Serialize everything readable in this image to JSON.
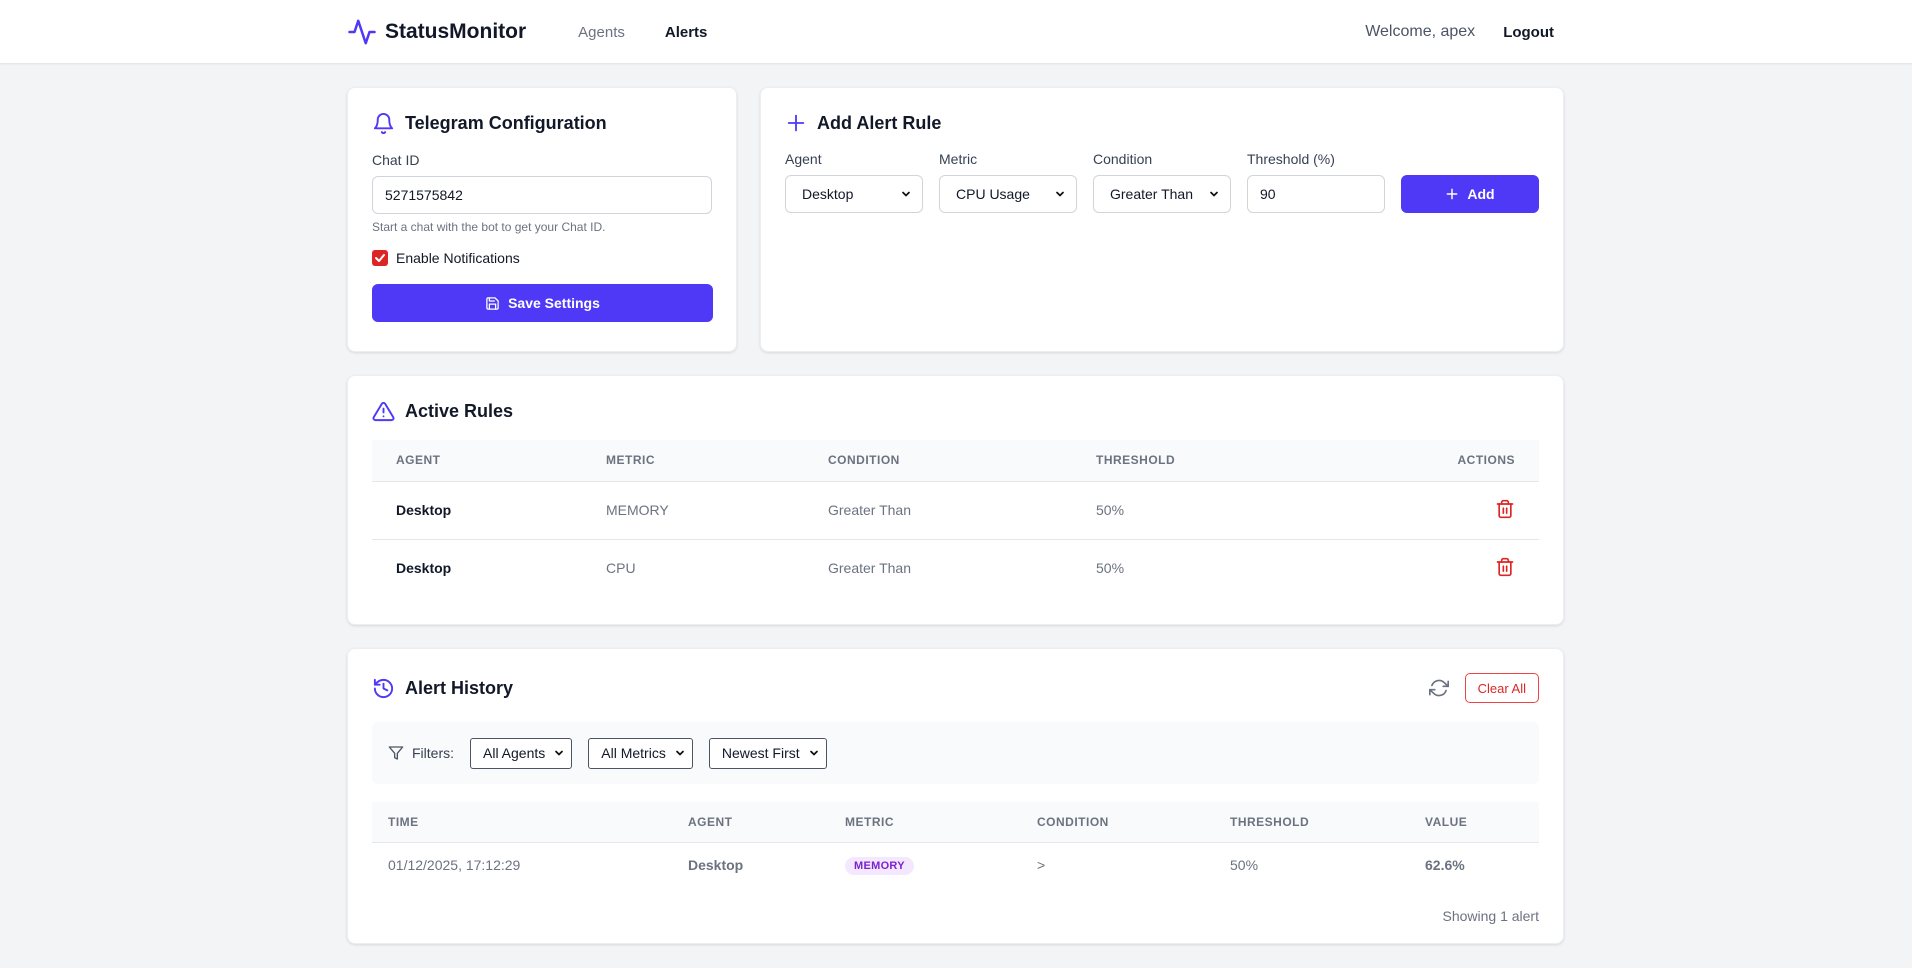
{
  "header": {
    "brand": "StatusMonitor",
    "nav": [
      {
        "label": "Agents"
      },
      {
        "label": "Alerts"
      }
    ],
    "welcome": "Welcome, apex",
    "logout": "Logout",
    "accent_color": "#4f39f6"
  },
  "telegram": {
    "title": "Telegram Configuration",
    "chat_id_label": "Chat ID",
    "chat_id_value": "5271575842",
    "hint": "Start a chat with the bot to get your Chat ID.",
    "enable_label": "Enable Notifications",
    "enabled": true,
    "save_label": "Save Settings"
  },
  "add_rule": {
    "title": "Add Alert Rule",
    "agent_label": "Agent",
    "agent_value": "Desktop",
    "metric_label": "Metric",
    "metric_value": "CPU Usage",
    "condition_label": "Condition",
    "condition_value": "Greater Than",
    "threshold_label": "Threshold (%)",
    "threshold_value": "90",
    "add_label": "Add"
  },
  "active_rules": {
    "title": "Active Rules",
    "columns": [
      "AGENT",
      "METRIC",
      "CONDITION",
      "THRESHOLD",
      "ACTIONS"
    ],
    "rows": [
      {
        "agent": "Desktop",
        "metric": "MEMORY",
        "condition": "Greater Than",
        "threshold": "50%"
      },
      {
        "agent": "Desktop",
        "metric": "CPU",
        "condition": "Greater Than",
        "threshold": "50%"
      }
    ]
  },
  "history": {
    "title": "Alert History",
    "clear_label": "Clear All",
    "filters_label": "Filters:",
    "filter_agents": "All Agents",
    "filter_metrics": "All Metrics",
    "filter_sort": "Newest First",
    "columns": [
      "TIME",
      "AGENT",
      "METRIC",
      "CONDITION",
      "THRESHOLD",
      "VALUE"
    ],
    "rows": [
      {
        "time": "01/12/2025, 17:12:29",
        "agent": "Desktop",
        "metric": "MEMORY",
        "condition": ">",
        "threshold": "50%",
        "value": "62.6%"
      }
    ],
    "footer": "Showing 1 alert"
  }
}
